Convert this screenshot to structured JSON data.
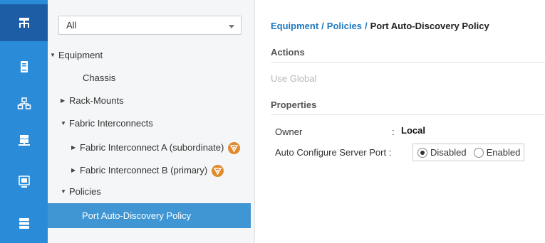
{
  "rail": {
    "icons": [
      "network-icon",
      "server-icon",
      "lan-icon",
      "storage-icon",
      "monitor-icon",
      "admin-icon"
    ]
  },
  "tree": {
    "filter_value": "All",
    "nodes": {
      "equipment": "Equipment",
      "chassis": "Chassis",
      "rack_mounts": "Rack-Mounts",
      "fabric_interconnects": "Fabric Interconnects",
      "fi_a": "Fabric Interconnect A (subordinate)",
      "fi_b": "Fabric Interconnect B (primary)",
      "policies": "Policies",
      "port_policy": "Port Auto-Discovery Policy"
    }
  },
  "breadcrumb": {
    "items": [
      "Equipment",
      "Policies",
      "Port Auto-Discovery Policy"
    ],
    "separator": "/"
  },
  "content": {
    "actions_header": "Actions",
    "use_global": "Use Global",
    "properties_header": "Properties",
    "owner_label": "Owner",
    "owner_value": "Local",
    "owner_sep": ":",
    "auto_config_label": "Auto Configure Server Port :",
    "options": [
      "Disabled",
      "Enabled"
    ],
    "selected_option": "Disabled"
  },
  "colors": {
    "rail_bg": "#2a8cd8",
    "rail_active": "#1d5da5",
    "selected_bg": "#4095d3",
    "link": "#1f7ac1",
    "warning_badge": "#e08a2e"
  }
}
